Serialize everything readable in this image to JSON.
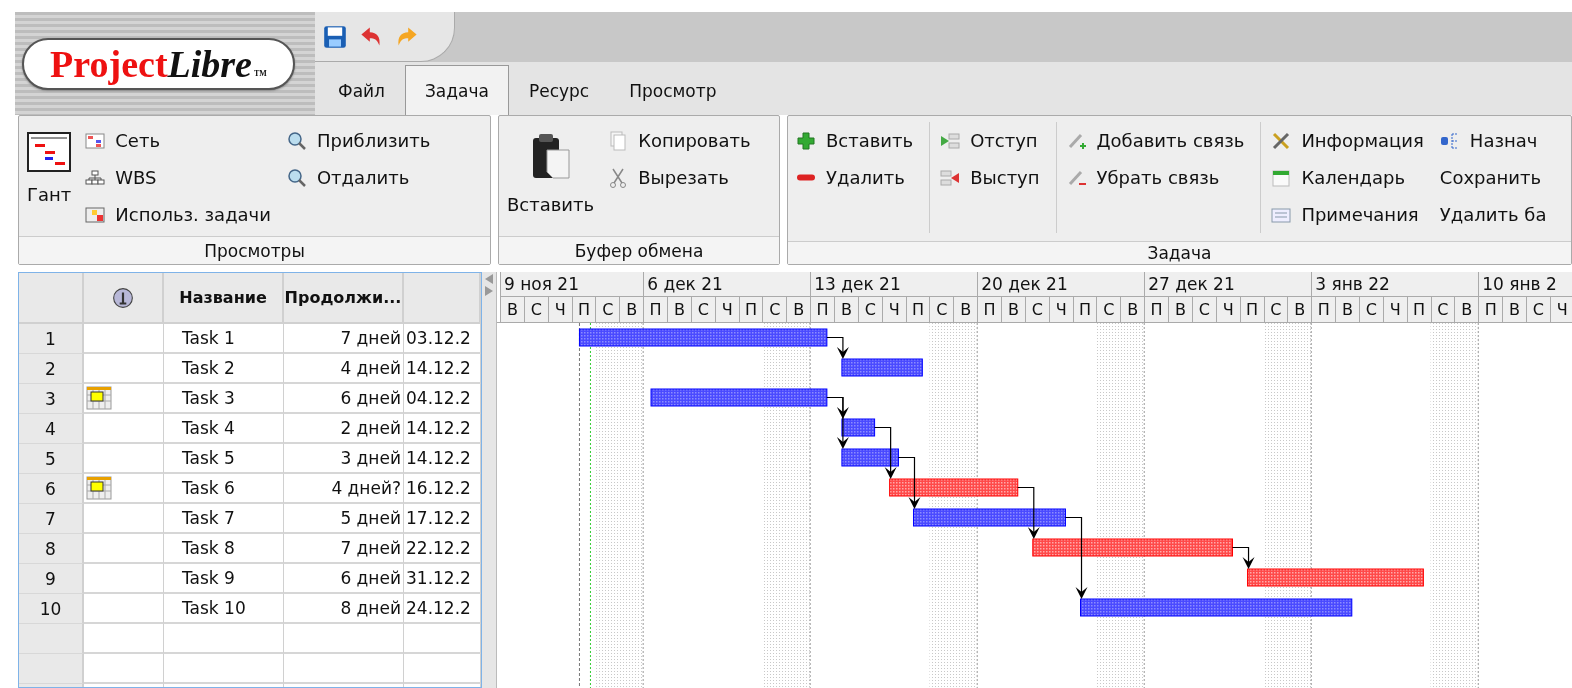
{
  "logo": {
    "brand": "Project",
    "accent": "Libre",
    "mark": "TM"
  },
  "quick_access": [
    {
      "kind": "save"
    },
    {
      "kind": "undo"
    },
    {
      "kind": "redo"
    }
  ],
  "tabs": [
    {
      "label": "Файл",
      "selected": false
    },
    {
      "label": "Задача",
      "selected": true
    },
    {
      "label": "Ресурс",
      "selected": false
    },
    {
      "label": "Просмотр",
      "selected": false
    }
  ],
  "ribbon": {
    "groups": [
      {
        "title": "Просмотры",
        "columns": [
          {
            "kind": "plain",
            "items": [
              {
                "label": "Гант",
                "kind": "gantt"
              }
            ]
          },
          {
            "kind": "plain",
            "items": [
              {
                "label": "Сеть",
                "kind": "network"
              },
              {
                "label": "WBS",
                "kind": "wbs"
              },
              {
                "label": "Использ. задачи",
                "kind": "usage"
              }
            ]
          },
          {
            "kind": "plain",
            "items": [
              {
                "label": "Приблизить",
                "kind": "zoomin"
              },
              {
                "label": "Отдалить",
                "kind": "zoomout"
              }
            ]
          }
        ]
      },
      {
        "title": "Буфер обмена",
        "columns": [
          {
            "kind": "plain",
            "items": [
              {
                "label": "Вставить",
                "kind": "paste"
              }
            ]
          },
          {
            "kind": "plain",
            "items": [
              {
                "label": "Копировать",
                "kind": "copy"
              },
              {
                "label": "Вырезать",
                "kind": "cut"
              }
            ]
          }
        ]
      },
      {
        "title": "Задача",
        "columns": [
          {
            "kind": "plain",
            "items": [
              {
                "label": "Вставить",
                "kind": "add"
              },
              {
                "label": "Удалить",
                "kind": "remove"
              }
            ]
          },
          {
            "kind": "divided",
            "items": [
              {
                "label": "Отступ",
                "kind": "indent"
              },
              {
                "label": "Выступ",
                "kind": "outdent"
              }
            ]
          },
          {
            "kind": "divided",
            "items": [
              {
                "label": "Добавить связь",
                "kind": "link"
              },
              {
                "label": "Убрать связь",
                "kind": "unlink"
              }
            ]
          },
          {
            "kind": "divided",
            "items": [
              {
                "label": "Информация",
                "kind": "info"
              },
              {
                "label": "Календарь",
                "kind": "calendar"
              },
              {
                "label": "Примечания",
                "kind": "notes"
              }
            ]
          },
          {
            "kind": "plain",
            "items": [
              {
                "label": "Назнач",
                "kind": "assign"
              },
              {
                "label": "Сохранить",
                "kind": "text"
              },
              {
                "label": "Удалить ба",
                "kind": "text"
              }
            ]
          }
        ]
      }
    ]
  },
  "table": {
    "columns": [
      {
        "kind": "indicators"
      },
      {
        "kind": "text",
        "label": "Название"
      },
      {
        "kind": "text",
        "label": "Продолжи..."
      }
    ],
    "rows": [
      {
        "number": "1",
        "indicator": false,
        "name": "Task 1",
        "duration": "7 дней",
        "start": "03.12.2",
        "critical": false
      },
      {
        "number": "2",
        "indicator": false,
        "name": "Task 2",
        "duration": "4 дней",
        "start": "14.12.2",
        "critical": false
      },
      {
        "number": "3",
        "indicator": true,
        "name": "Task 3",
        "duration": "6 дней",
        "start": "04.12.2",
        "critical": false
      },
      {
        "number": "4",
        "indicator": false,
        "name": "Task 4",
        "duration": "2 дней",
        "start": "14.12.2",
        "critical": false
      },
      {
        "number": "5",
        "indicator": false,
        "name": "Task 5",
        "duration": "3 дней",
        "start": "14.12.2",
        "critical": false
      },
      {
        "number": "6",
        "indicator": true,
        "name": "Task 6",
        "duration": "4 дней?",
        "start": "16.12.2",
        "critical": true
      },
      {
        "number": "7",
        "indicator": false,
        "name": "Task 7",
        "duration": "5 дней",
        "start": "17.12.2",
        "critical": false
      },
      {
        "number": "8",
        "indicator": false,
        "name": "Task 8",
        "duration": "7 дней",
        "start": "22.12.2",
        "critical": true
      },
      {
        "number": "9",
        "indicator": false,
        "name": "Task 9",
        "duration": "6 дней",
        "start": "31.12.2",
        "critical": true
      },
      {
        "number": "10",
        "indicator": false,
        "name": "Task 10",
        "duration": "8 дней",
        "start": "24.12.2",
        "critical": false
      }
    ]
  },
  "timeline": {
    "weeks": [
      {
        "label": "9 ноя 21",
        "days": [
          "В",
          "С",
          "Ч",
          "П",
          "С",
          "В"
        ]
      },
      {
        "label": "6 дек 21",
        "days": [
          "П",
          "В",
          "С",
          "Ч",
          "П",
          "С",
          "В"
        ]
      },
      {
        "label": "13 дек 21",
        "days": [
          "П",
          "В",
          "С",
          "Ч",
          "П",
          "С",
          "В"
        ]
      },
      {
        "label": "20 дек 21",
        "days": [
          "П",
          "В",
          "С",
          "Ч",
          "П",
          "С",
          "В"
        ]
      },
      {
        "label": "27 дек 21",
        "days": [
          "П",
          "В",
          "С",
          "Ч",
          "П",
          "С",
          "В"
        ]
      },
      {
        "label": "3 янв 22",
        "days": [
          "П",
          "В",
          "С",
          "Ч",
          "П",
          "С",
          "В"
        ]
      },
      {
        "label": "10 янв 2",
        "days": [
          "П",
          "В",
          "С",
          "Ч"
        ]
      }
    ]
  }
}
